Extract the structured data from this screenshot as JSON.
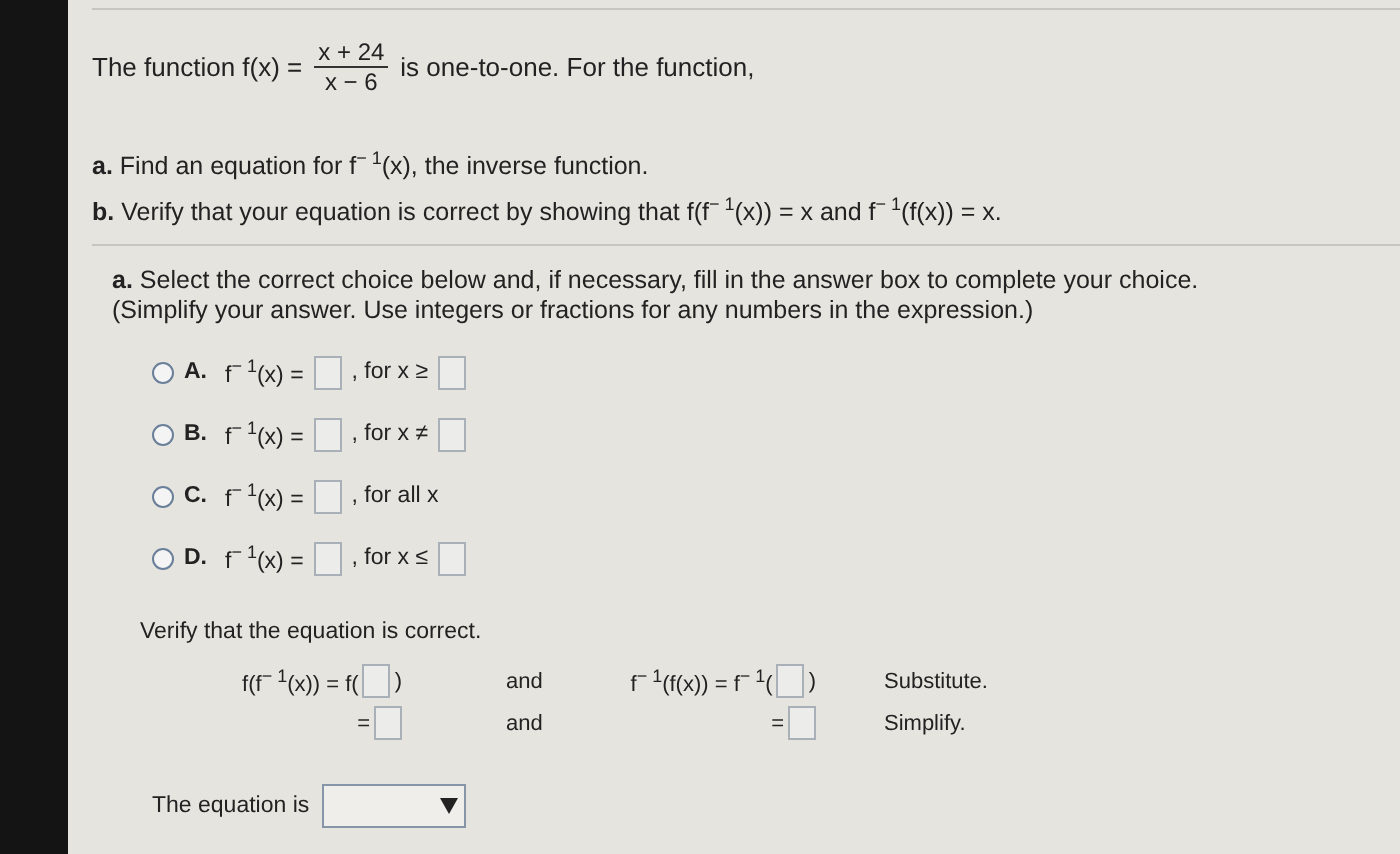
{
  "intro": {
    "before": "The function f(x) =",
    "numerator": "x + 24",
    "denominator": "x − 6",
    "after": "is one-to-one. For the function,"
  },
  "tasks": [
    {
      "label": "a.",
      "text": "Find an equation for f$^{− 1}$(x), the inverse function."
    },
    {
      "label": "b.",
      "text": "Verify that your equation is correct by showing that f(f$^{− 1}$(x)) = x and f$^{− 1}$(f(x)) = x."
    }
  ],
  "part_a": {
    "label": "a.",
    "instruction": "Select the correct choice below and, if necessary, fill in the answer box to complete your choice.",
    "hint": "(Simplify your answer. Use integers or fractions for any numbers in the expression.)"
  },
  "choices": [
    {
      "letter": "A.",
      "lhs": "f$^{− 1}$(x) =",
      "condition": ", for x ≥",
      "kind": "with-box",
      "selected": false
    },
    {
      "letter": "B.",
      "lhs": "f$^{− 1}$(x) =",
      "condition": ", for x ≠",
      "kind": "with-box",
      "selected": false
    },
    {
      "letter": "C.",
      "lhs": "f$^{− 1}$(x) =",
      "condition": ", for all x",
      "kind": "no-box",
      "selected": false
    },
    {
      "letter": "D.",
      "lhs": "f$^{− 1}$(x) =",
      "condition": ", for x ≤",
      "kind": "with-box",
      "selected": false
    }
  ],
  "verify": {
    "title": "Verify that the equation is correct.",
    "rows": [
      {
        "kind": "substitute",
        "left": "f(f$^{− 1}$(x)) = f(",
        "left_close": ")",
        "middle": "and",
        "right": "f$^{− 1}$(f(x)) = f$^{− 1}$(",
        "right_close": ")",
        "note": "Substitute."
      },
      {
        "kind": "simplify",
        "left": "=",
        "middle": "and",
        "right": "=",
        "note": "Simplify."
      }
    ]
  },
  "conclusion": {
    "label": "The equation is"
  }
}
